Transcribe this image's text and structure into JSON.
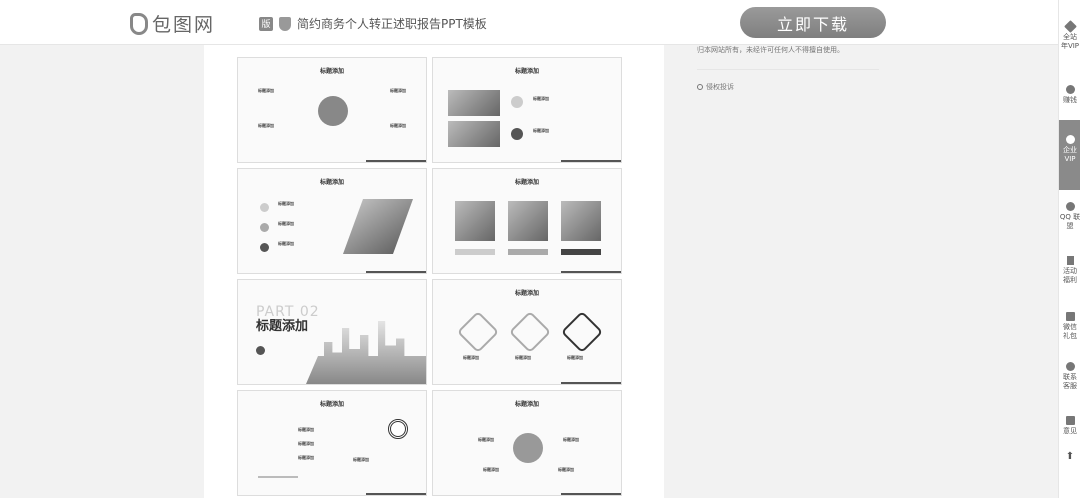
{
  "header": {
    "logo_text": "包图网",
    "badge": "版",
    "doc_title": "简约商务个人转正述职报告PPT模板",
    "download_label": "立即下载"
  },
  "right_panel": {
    "copyright": "归本网站所有，未经许可任何人不得擅自使用。",
    "report_label": "侵权投诉"
  },
  "slides": {
    "heading": "标题添加",
    "item_label": "标题添加",
    "part_label": "PART 02",
    "part_title": "标题添加"
  },
  "sidebar": {
    "items": [
      {
        "label": "全站 年VIP",
        "icon": "diamond-icon"
      },
      {
        "label": "赚钱",
        "icon": "coin-icon"
      },
      {
        "label": "企业 VIP",
        "icon": "enterprise-icon"
      },
      {
        "label": "QQ 联盟",
        "icon": "qq-icon"
      },
      {
        "label": "活动 福利",
        "icon": "flag-icon"
      },
      {
        "label": "微信 礼包",
        "icon": "gift-icon"
      },
      {
        "label": "联系 客服",
        "icon": "help-icon"
      },
      {
        "label": "意见",
        "icon": "edit-icon"
      },
      {
        "label": "",
        "icon": "back-to-top-icon"
      }
    ]
  }
}
